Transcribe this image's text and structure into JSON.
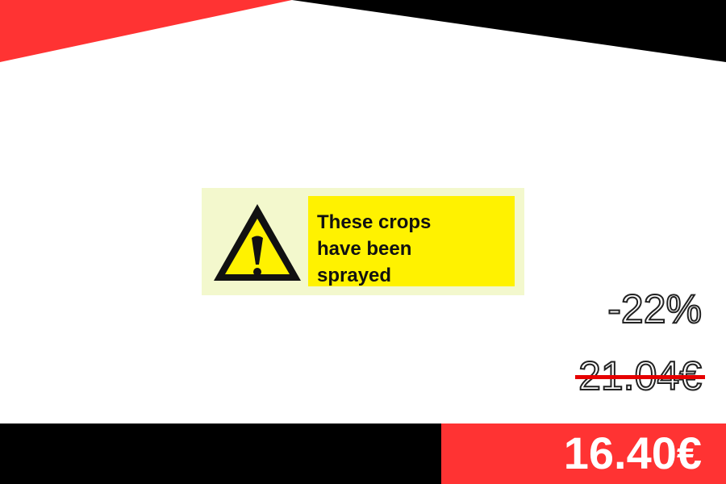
{
  "colors": {
    "accent_red": "#ff3333",
    "band_black": "#000000",
    "strike_red": "#e60000",
    "sign_yellow": "#fff200",
    "sign_background": "#f3f8cd"
  },
  "product": {
    "sign_lines": [
      "These crops",
      "have been",
      "sprayed"
    ],
    "icon": "warning-triangle-icon"
  },
  "pricing": {
    "discount": "-22%",
    "old_price": "21.04€",
    "new_price": "16.40€"
  }
}
